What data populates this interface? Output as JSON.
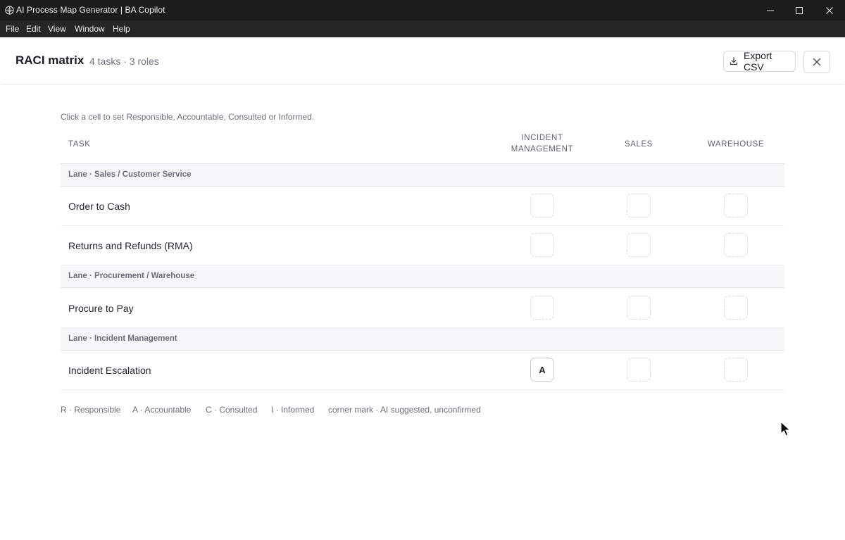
{
  "window": {
    "title": "AI Process Map Generator | BA Copilot"
  },
  "menu": [
    "File",
    "Edit",
    "View",
    "Window",
    "Help"
  ],
  "header": {
    "title": "RACI matrix",
    "meta": "4 tasks · 3 roles",
    "export_label": "Export CSV"
  },
  "hint": "Click a cell to set Responsible, Accountable, Consulted or Informed.",
  "table": {
    "task_header": "TASK",
    "roles": [
      {
        "line1": "INCIDENT",
        "line2": "MANAGEMENT"
      },
      {
        "line1": "SALES",
        "line2": ""
      },
      {
        "line1": "WAREHOUSE",
        "line2": ""
      }
    ],
    "lanes": [
      {
        "label": "Lane · Sales / Customer Service"
      },
      {
        "label": "Lane · Procurement / Warehouse"
      },
      {
        "label": "Lane · Incident Management"
      }
    ],
    "tasks": [
      {
        "name": "Order to Cash",
        "cells": [
          "",
          "",
          ""
        ]
      },
      {
        "name": "Returns and Refunds (RMA)",
        "cells": [
          "",
          "",
          ""
        ]
      },
      {
        "name": "Procure to Pay",
        "cells": [
          "",
          "",
          ""
        ]
      },
      {
        "name": "Incident Escalation",
        "cells": [
          "A",
          "",
          ""
        ]
      }
    ]
  },
  "legend": {
    "r": "R · Responsible",
    "a": "A · Accountable",
    "c": "C · Consulted",
    "i": "I · Informed",
    "mark": "corner mark · AI suggested, unconfirmed"
  }
}
